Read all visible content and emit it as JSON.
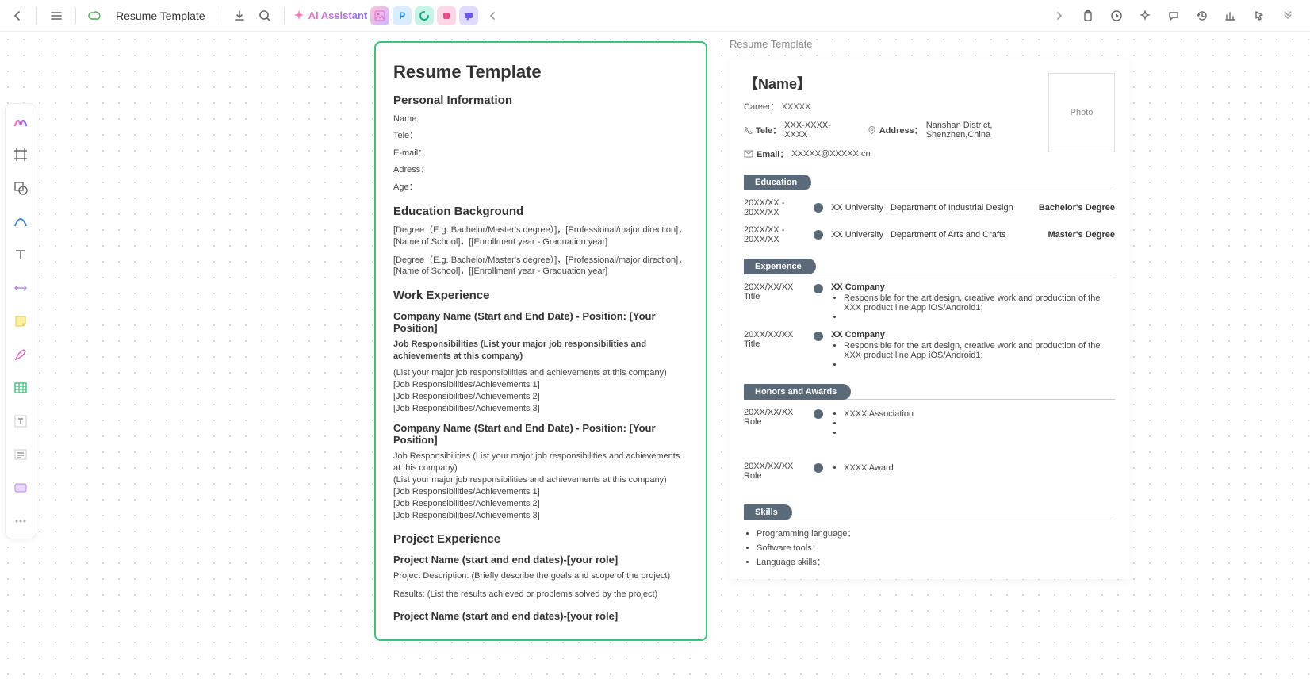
{
  "topbar": {
    "doc_title": "Resume Template",
    "ai_label": "AI Assistant"
  },
  "tab_label": "Resume Template",
  "template": {
    "title": "Resume Template",
    "h_personal": "Personal Information",
    "name_lbl": "Name:",
    "tele_lbl": "Tele：",
    "email_lbl": "E-mail：",
    "address_lbl": "Adress：",
    "age_lbl": "Age：",
    "h_edu": "Education Background",
    "edu_tpl1": "[Degree（E.g. Bachelor/Master's degree）]，[Professional/major direction]，[Name of School]，[[Enrollment year - Graduation year]",
    "edu_tpl2": "[Degree（E.g. Bachelor/Master's degree）]，[Professional/major direction]，[Name of School]，[[Enrollment year - Graduation year]",
    "h_work": "Work Experience",
    "co_hdr1": "Company Name (Start and End Date) - Position: [Your Position]",
    "jr_bold": "Job Responsibilities (List your major job responsibilities and achievements at this company)",
    "jr_l1": "(List your major job responsibilities and achievements at this company)",
    "jr_l2": "[Job Responsibilities/Achievements 1]",
    "jr_l3": "[Job Responsibilities/Achievements 2]",
    "jr_l4": "[Job Responsibilities/Achievements 3]",
    "co_hdr2": "Company Name (Start and End Date) - Position: [Your Position]",
    "jr2_a": "Job Responsibilities (List your major job responsibilities and achievements at this company)",
    "jr2_b": "(List your major job responsibilities and achievements at this company)",
    "jr2_c": "[Job Responsibilities/Achievements 1]",
    "jr2_d": "[Job Responsibilities/Achievements 2]",
    "jr2_e": "[Job Responsibilities/Achievements 3]",
    "h_proj": "Project Experience",
    "proj_hdr1": "Project Name (start and end dates)-[your role]",
    "proj_desc": "Project Description: (Briefly describe the goals and scope of the project)",
    "proj_res": "Results: (List the results achieved or problems solved by the project)",
    "proj_hdr2": "Project Name (start and end dates)-[your role]"
  },
  "resume": {
    "name": "【Name】",
    "career": "Career：  XXXXX",
    "tele_lbl": "Tele：",
    "tele_val": "XXX-XXXX-XXXX",
    "addr_lbl": "Address：",
    "addr_val": "Nanshan District, Shenzhen,China",
    "email_lbl": "Email：",
    "email_val": "XXXXX@XXXXX.cn",
    "photo": "Photo",
    "sec_edu": "Education",
    "edu1_date": "20XX/XX - 20XX/XX",
    "edu1_txt": "XX University | Department of Industrial Design",
    "edu1_deg": "Bachelor's  Degree",
    "edu2_date": "20XX/XX - 20XX/XX",
    "edu2_txt": "XX University | Department of Arts and Crafts",
    "edu2_deg": "Master's Degree",
    "sec_exp": "Experience",
    "exp1_date": "20XX/XX/XX",
    "exp1_title": "Title",
    "exp1_co": "XX Company",
    "exp1_b1": "Responsible for the art design, creative work and production of the XXX product line App iOS/Android1;",
    "exp2_date": "20XX/XX/XX",
    "exp2_title": "Title",
    "exp2_co": "XX Company",
    "exp2_b1": "Responsible for the art design, creative work and production of the XXX product line App iOS/Android1;",
    "sec_honors": "Honors and Awards",
    "hon1_date": "20XX/XX/XX",
    "hon1_role": "Role",
    "hon1_b1": "XXXX Association",
    "hon2_date": "20XX/XX/XX",
    "hon2_role": "Role",
    "hon2_b1": "XXXX Award",
    "sec_skills": "Skills",
    "sk1": "Programming language：",
    "sk2": "Software tools：",
    "sk3": "Language skills："
  }
}
